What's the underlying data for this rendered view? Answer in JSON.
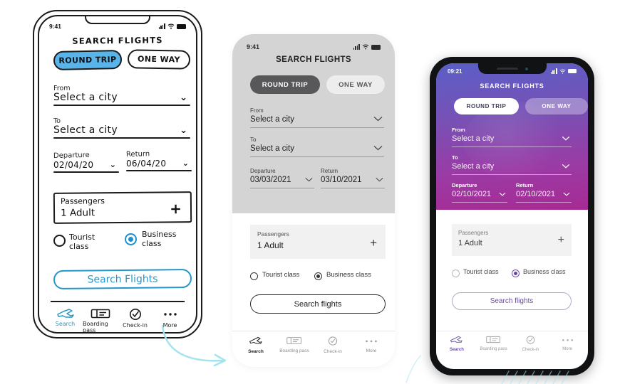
{
  "meta": {
    "scene": "three-phone-mockup-progression",
    "accent_blue": "#2596c8",
    "sketch_fill": "#59b4ea",
    "gray_active": "#58575a",
    "gradient_start": "#5a5fc7",
    "gradient_end": "#a62a93",
    "purple_accent": "#6a4fa0",
    "arrow_color": "#a5e4ef"
  },
  "phone1": {
    "style": "hand-drawn-wireframe",
    "status": {
      "time": "9:41",
      "signal_icon": "signal-bars-icon",
      "wifi_icon": "wifi-icon",
      "battery_icon": "battery-icon"
    },
    "title": "SEARCH FLIGHTS",
    "trip_toggle": {
      "round_label": "ROUND TRIP",
      "oneway_label": "ONE WAY",
      "selected": "ROUND TRIP"
    },
    "from": {
      "label": "From",
      "value": "Select a city",
      "chevron": "chevron-down-icon"
    },
    "to": {
      "label": "To",
      "value": "Select a city",
      "chevron": "chevron-down-icon"
    },
    "departure": {
      "label": "Departure",
      "value": "02/04/20",
      "chevron": "chevron-down-icon"
    },
    "return": {
      "label": "Return",
      "value": "06/04/20",
      "chevron": "chevron-down-icon"
    },
    "passengers": {
      "label": "Passengers",
      "value": "1 Adult",
      "add": "+"
    },
    "classes": {
      "tourist": "Tourist\nclass",
      "tourist_line1": "Tourist",
      "tourist_line2": "class",
      "business_line1": "Business",
      "business_line2": "class",
      "selected": "Business class"
    },
    "search_button": "Search Flights",
    "nav": [
      {
        "label": "Search",
        "icon": "airplane-icon",
        "active": true
      },
      {
        "label": "Boarding pass",
        "icon": "ticket-icon",
        "active": false
      },
      {
        "label": "Check-in",
        "icon": "check-circle-icon",
        "active": false
      },
      {
        "label": "More",
        "icon": "ellipsis-icon",
        "active": false
      }
    ]
  },
  "phone2": {
    "style": "grayscale-flat-mockup",
    "status": {
      "time": "9:41",
      "signal_icon": "signal-bars-icon",
      "wifi_icon": "wifi-icon",
      "battery_icon": "battery-icon"
    },
    "title": "SEARCH FLIGHTS",
    "trip_toggle": {
      "round_label": "ROUND TRIP",
      "oneway_label": "ONE WAY",
      "selected": "ROUND TRIP"
    },
    "from": {
      "label": "From",
      "value": "Select a city",
      "chevron": "chevron-down-icon"
    },
    "to": {
      "label": "To",
      "value": "Select a city",
      "chevron": "chevron-down-icon"
    },
    "departure": {
      "label": "Departure",
      "value": "03/03/2021",
      "chevron": "chevron-down-icon"
    },
    "return": {
      "label": "Return",
      "value": "03/10/2021",
      "chevron": "chevron-down-icon"
    },
    "passengers": {
      "label": "Passengers",
      "value": "1 Adult",
      "add": "+"
    },
    "classes": {
      "tourist": "Tourist class",
      "business": "Business class",
      "selected": "Business class"
    },
    "search_button": "Search flights",
    "nav": [
      {
        "label": "Search",
        "icon": "airplane-icon",
        "active": true
      },
      {
        "label": "Boarding pass",
        "icon": "ticket-icon",
        "active": false
      },
      {
        "label": "Check-in",
        "icon": "check-circle-icon",
        "active": false
      },
      {
        "label": "More",
        "icon": "ellipsis-icon",
        "active": false
      }
    ]
  },
  "phone3": {
    "style": "full-color-gradient",
    "status": {
      "time": "09:21",
      "signal_icon": "signal-bars-icon",
      "wifi_icon": "wifi-icon",
      "battery_icon": "battery-icon"
    },
    "title": "SEARCH FLIGHTS",
    "trip_toggle": {
      "round_label": "ROUND TRIP",
      "oneway_label": "ONE WAY",
      "selected": "ROUND TRIP"
    },
    "from": {
      "label": "From",
      "value": "Select a city",
      "chevron": "chevron-down-icon"
    },
    "to": {
      "label": "To",
      "value": "Select a city",
      "chevron": "chevron-down-icon"
    },
    "departure": {
      "label": "Departure",
      "value": "02/10/2021",
      "chevron": "chevron-down-icon"
    },
    "return": {
      "label": "Return",
      "value": "02/10/2021",
      "chevron": "chevron-down-icon"
    },
    "passengers": {
      "label": "Passengers",
      "value": "1 Adult",
      "add": "+"
    },
    "classes": {
      "tourist": "Tourist class",
      "business": "Business class",
      "selected": "Business class"
    },
    "search_button": "Search flights",
    "nav": [
      {
        "label": "Search",
        "icon": "airplane-icon",
        "active": true
      },
      {
        "label": "Boarding pass",
        "icon": "ticket-icon",
        "active": false
      },
      {
        "label": "Check-in",
        "icon": "check-circle-icon",
        "active": false
      },
      {
        "label": "More",
        "icon": "ellipsis-icon",
        "active": false
      }
    ]
  }
}
